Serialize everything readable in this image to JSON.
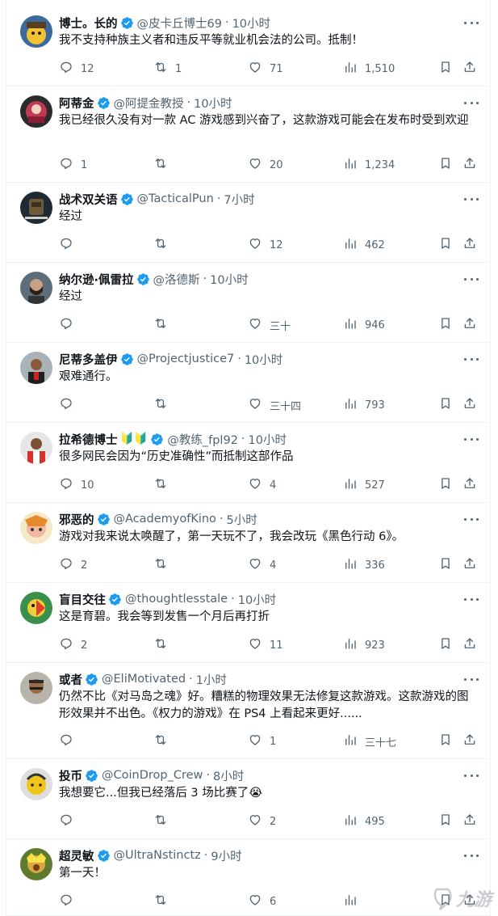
{
  "colors": {
    "verified": "#1d9bf0",
    "meta": "#536471",
    "text": "#0f1419",
    "divider": "#eff3f4"
  },
  "tweets": [
    {
      "name": "博士。长的",
      "handle": "@皮卡丘博士69",
      "time": "10小时",
      "text": "我不支持种族主义者和违反平等就业机会法的公司。抵制！",
      "replies": "12",
      "retweets": "1",
      "likes": "71",
      "views": "1,510"
    },
    {
      "name": "阿蒂金",
      "handle": "@阿提金教授",
      "time": "10小时",
      "text": "我已经很久没有对一款 AC 游戏感到兴奋了，这款游戏可能会在发布时受到欢迎",
      "replies": "1",
      "retweets": "",
      "likes": "20",
      "views": "1,234"
    },
    {
      "name": "战术双关语",
      "handle": "@TacticalPun",
      "time": "7小时",
      "text": "经过",
      "replies": "",
      "retweets": "",
      "likes": "12",
      "views": "462"
    },
    {
      "name": "纳尔逊·佩雷拉",
      "handle": "@洛德斯",
      "time": "10小时",
      "text": "经过",
      "replies": "",
      "retweets": "",
      "likes": "三十",
      "views": "946"
    },
    {
      "name": "尼蒂多盖伊",
      "handle": "@Projectjustice7",
      "time": "10小时",
      "text": "艰难通行。",
      "replies": "",
      "retweets": "",
      "likes": "三十四",
      "views": "793"
    },
    {
      "name": "拉希德博士",
      "badge": "🔰🔰",
      "handle": "@教练_fpl92",
      "time": "10小时",
      "text": "很多网民会因为“历史准确性”而抵制这部作品",
      "replies": "10",
      "retweets": "",
      "likes": "4",
      "views": "527"
    },
    {
      "name": "邪恶的",
      "handle": "@AcademyofKino",
      "time": "5小时",
      "text": "游戏对我来说太唤醒了，第一天玩不了，我会改玩《黑色行动 6》。",
      "replies": "2",
      "retweets": "",
      "likes": "4",
      "views": "336"
    },
    {
      "name": "盲目交往",
      "handle": "@thoughtlesstale",
      "time": "10小时",
      "text": "这是育碧。我会等到发售一个月后再打折",
      "replies": "2",
      "retweets": "",
      "likes": "11",
      "views": "923"
    },
    {
      "name": "或者",
      "handle": "@EliMotivated",
      "time": "1小时",
      "text": "仍然不比《对马岛之魂》好。糟糕的物理效果无法修复这款游戏。这款游戏的图形效果并不出色。《权力的游戏》在 PS4 上看起来更好......",
      "replies": "",
      "retweets": "",
      "likes": "1",
      "views": "三十七"
    },
    {
      "name": "投币",
      "handle": "@CoinDrop_Crew",
      "time": "8小时",
      "text": "我想要它...但我已经落后 3 场比赛了😭",
      "replies": "",
      "retweets": "",
      "likes": "2",
      "views": "495"
    },
    {
      "name": "超灵敏",
      "handle": "@UltraNstinctz",
      "time": "9小时",
      "text": "第一天！",
      "replies": "",
      "retweets": "",
      "likes": "6",
      "views": ""
    }
  ],
  "watermark": {
    "text": "九游"
  }
}
